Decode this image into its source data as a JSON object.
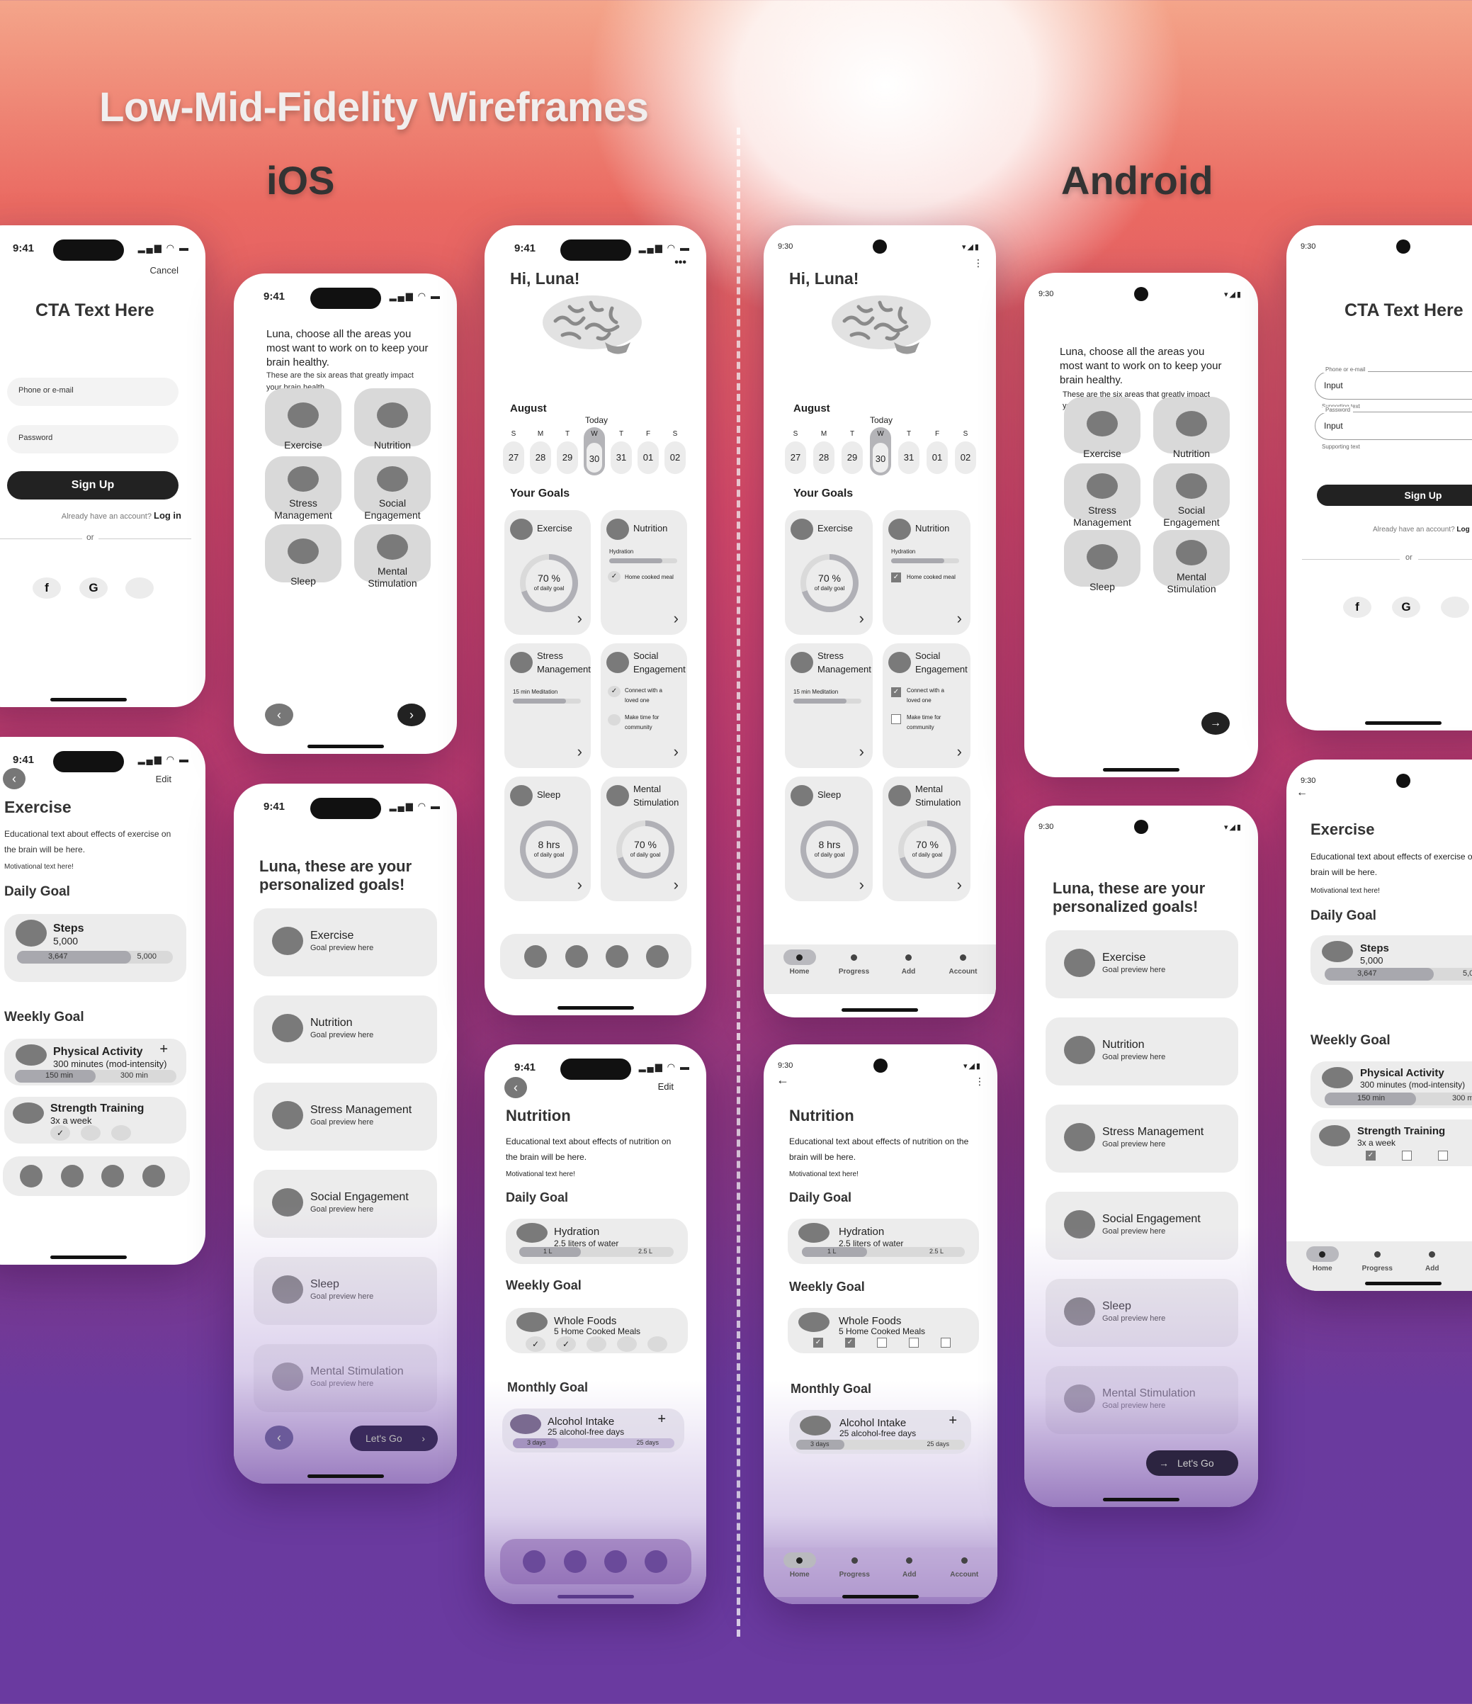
{
  "header": {
    "title": "Low-Mid-Fidelity Wireframes",
    "ios_label": "iOS",
    "android_label": "Android"
  },
  "ios": {
    "status_time": "9:41",
    "signup": {
      "cancel": "Cancel",
      "cta": "CTA Text Here",
      "phone_placeholder": "Phone or e-mail",
      "password_placeholder": "Password",
      "signup_button": "Sign Up",
      "already": "Already have an account?",
      "login": "Log in",
      "or": "or",
      "social": [
        "facebook",
        "google",
        "apple"
      ]
    },
    "choose": {
      "heading": "Luna, choose all the areas you most want to work on to keep your brain healthy.",
      "sub": "These are the six areas that greatly impact your brain health.",
      "areas": [
        "Exercise",
        "Nutrition",
        "Stress Management",
        "Social Engagement",
        "Sleep",
        "Mental Stimulation"
      ]
    },
    "goals": {
      "heading": "Luna, these are your personalized goals!",
      "items": [
        {
          "title": "Exercise",
          "sub": "Goal preview here"
        },
        {
          "title": "Nutrition",
          "sub": "Goal preview here"
        },
        {
          "title": "Stress Management",
          "sub": "Goal preview here"
        },
        {
          "title": "Social Engagement",
          "sub": "Goal preview here"
        },
        {
          "title": "Sleep",
          "sub": "Goal preview here"
        },
        {
          "title": "Mental Stimulation",
          "sub": "Goal preview here"
        }
      ],
      "lets_go": "Let's Go"
    },
    "exercise": {
      "edit": "Edit",
      "title": "Exercise",
      "edu": "Educational text about effects of exercise on the brain will be here.",
      "motivation": "Motivational text here!",
      "daily_label": "Daily Goal",
      "steps_title": "Steps",
      "steps_target": "5,000",
      "steps_current": "3,647",
      "steps_max": "5,000",
      "steps_progress": 0.73,
      "weekly_label": "Weekly Goal",
      "pa_title": "Physical Activity",
      "pa_sub": "300 minutes (mod-intensity)",
      "pa_current": "150 min",
      "pa_max": "300 min",
      "pa_progress": 0.5,
      "st_title": "Strength Training",
      "st_sub": "3x a week",
      "st_checks": [
        true,
        false,
        false
      ]
    },
    "nutrition": {
      "edit": "Edit",
      "title": "Nutrition",
      "edu": "Educational text about effects of nutrition on the brain will be here.",
      "motivation": "Motivational text here!",
      "daily_label": "Daily Goal",
      "hyd_title": "Hydration",
      "hyd_sub": "2.5 liters of water",
      "hyd_current": "1 L",
      "hyd_max": "2.5 L",
      "hyd_progress": 0.4,
      "weekly_label": "Weekly Goal",
      "wf_title": "Whole Foods",
      "wf_sub": "5 Home Cooked Meals",
      "wf_checks": [
        true,
        true,
        false,
        false,
        false
      ],
      "monthly_label": "Monthly Goal",
      "al_title": "Alcohol Intake",
      "al_sub": "25 alcohol-free days",
      "al_current": "3 days",
      "al_max": "25 days",
      "al_progress": 0.12
    }
  },
  "home": {
    "greeting": "Hi, Luna!",
    "month": "August",
    "today": "Today",
    "days": [
      {
        "l": "S",
        "n": "27"
      },
      {
        "l": "M",
        "n": "28"
      },
      {
        "l": "T",
        "n": "29"
      },
      {
        "l": "W",
        "n": "30",
        "today": true
      },
      {
        "l": "T",
        "n": "31"
      },
      {
        "l": "F",
        "n": "01"
      },
      {
        "l": "S",
        "n": "02"
      }
    ],
    "your_goals": "Your Goals",
    "cards": {
      "exercise": "Exercise",
      "exercise_pct": "70 %",
      "exercise_pct_val": 0.7,
      "of_daily": "of daily goal",
      "nutrition": "Nutrition",
      "hydration": "Hydration",
      "hydration_progress": 0.78,
      "home_meal": "Home cooked meal",
      "stress1": "Stress",
      "stress2": "Management",
      "meditation": "15 min Meditation",
      "meditation_progress": 0.78,
      "social1": "Social",
      "social2": "Engagement",
      "connect": "Connect with a loved one",
      "community": "Make time for community",
      "sleep": "Sleep",
      "sleep_val": "8 hrs",
      "mental1": "Mental",
      "mental2": "Stimulation",
      "mental_pct": "70 %"
    },
    "nav": [
      "Home",
      "Progress",
      "Add",
      "Account"
    ]
  },
  "android": {
    "status_time": "9:30",
    "signup": {
      "cta": "CTA Text Here",
      "phone_label": "Phone or e-mail",
      "input_value": "Input",
      "supporting": "Supporting text",
      "password_label": "Password",
      "signup_button": "Sign Up",
      "already": "Already have an account?",
      "login": "Log in",
      "or": "or"
    },
    "exercise_st_checks": [
      true,
      false,
      false
    ]
  }
}
